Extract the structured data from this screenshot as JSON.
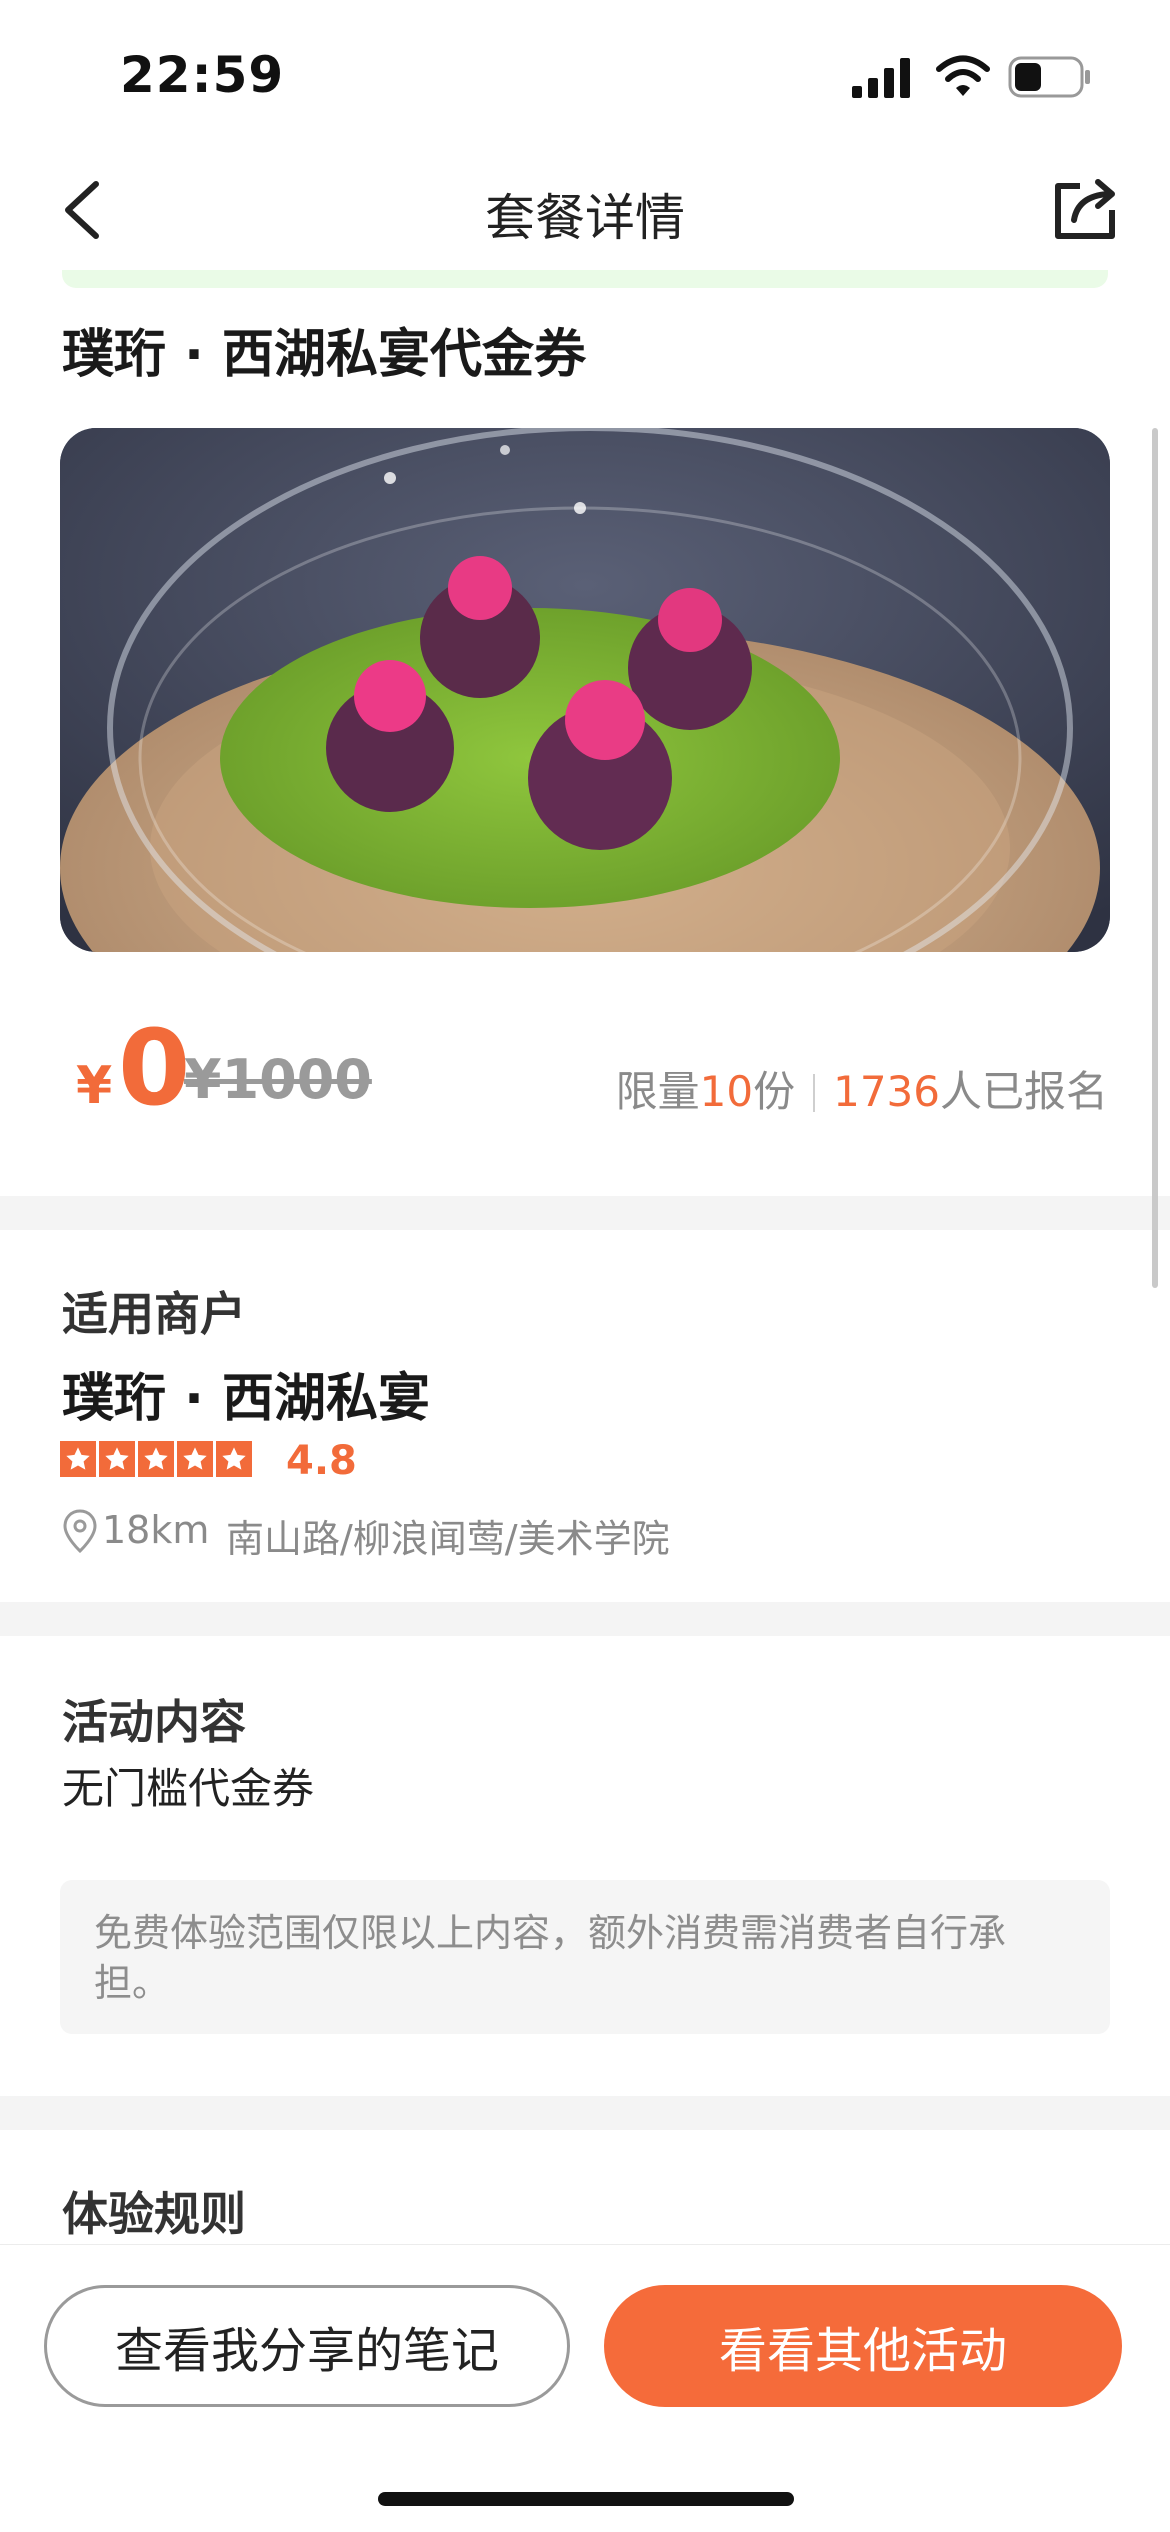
{
  "status_bar": {
    "time": "22:59",
    "icons": [
      "signal-icon",
      "wifi-icon",
      "battery-icon"
    ]
  },
  "nav": {
    "title": "套餐详情",
    "back_icon": "chevron-left-icon",
    "share_icon": "share-icon"
  },
  "package": {
    "title": "璞珩 · 西湖私宴代金券",
    "currency": "¥",
    "price": "0",
    "original_price": "¥1000",
    "limit_prefix": "限量",
    "limit_count": "10",
    "limit_suffix": "份",
    "signup_count": "1736",
    "signup_suffix": "人已报名"
  },
  "merchant": {
    "section_label": "适用商户",
    "name": "璞珩 · 西湖私宴",
    "stars": 5,
    "rating": "4.8",
    "distance": "18km",
    "address": "南山路/柳浪闻莺/美术学院"
  },
  "activity": {
    "section_label": "活动内容",
    "content": "无门槛代金券",
    "notice": "免费体验范围仅限以上内容，额外消费需消费者自行承担。"
  },
  "rules": {
    "section_label": "体验规则"
  },
  "bottom": {
    "notes_button": "查看我分享的笔记",
    "more_button": "看看其他活动"
  },
  "colors": {
    "accent": "#f26b3a",
    "button": "#f56b3a",
    "muted": "#8a8a8a"
  }
}
